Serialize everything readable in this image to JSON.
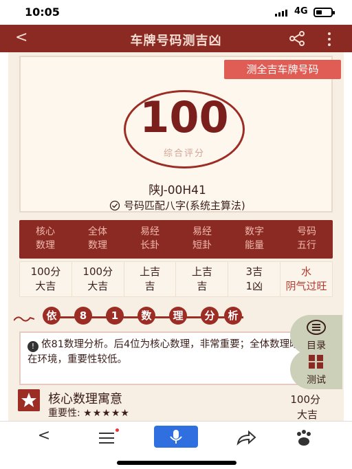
{
  "status": {
    "time": "10:05",
    "network": "4G"
  },
  "header": {
    "title": "车牌号码测吉凶"
  },
  "card": {
    "full_button": "测全吉车牌号码",
    "score": "100",
    "score_label": "综合评分",
    "plate": "陕J-00H41",
    "method": "号码匹配八字(系统主算法)"
  },
  "attrs": [
    {
      "label": "核心\n数理",
      "value": "100分\n大吉"
    },
    {
      "label": "全体\n数理",
      "value": "100分\n大吉"
    },
    {
      "label": "易经\n长卦",
      "value": "上吉\n吉"
    },
    {
      "label": "易经\n短卦",
      "value": "上吉\n吉"
    },
    {
      "label": "数字\n能量",
      "value": "3吉\n1凶"
    },
    {
      "label": "号码\n五行",
      "value": "水\n阴气过旺"
    }
  ],
  "section_title": [
    "依",
    "8",
    "1",
    "数",
    "理",
    "分",
    "析"
  ],
  "notice": "依81数理分析。后4位为核心数理，非常重要；全体数理暗示外在环境，重要性较低。",
  "core": {
    "title": "核心数理寓意",
    "importance_label": "重要性:",
    "stars": "★★★★★",
    "score": "100分",
    "grade": "大吉"
  },
  "floating": {
    "menu": "目录",
    "test": "测试"
  }
}
